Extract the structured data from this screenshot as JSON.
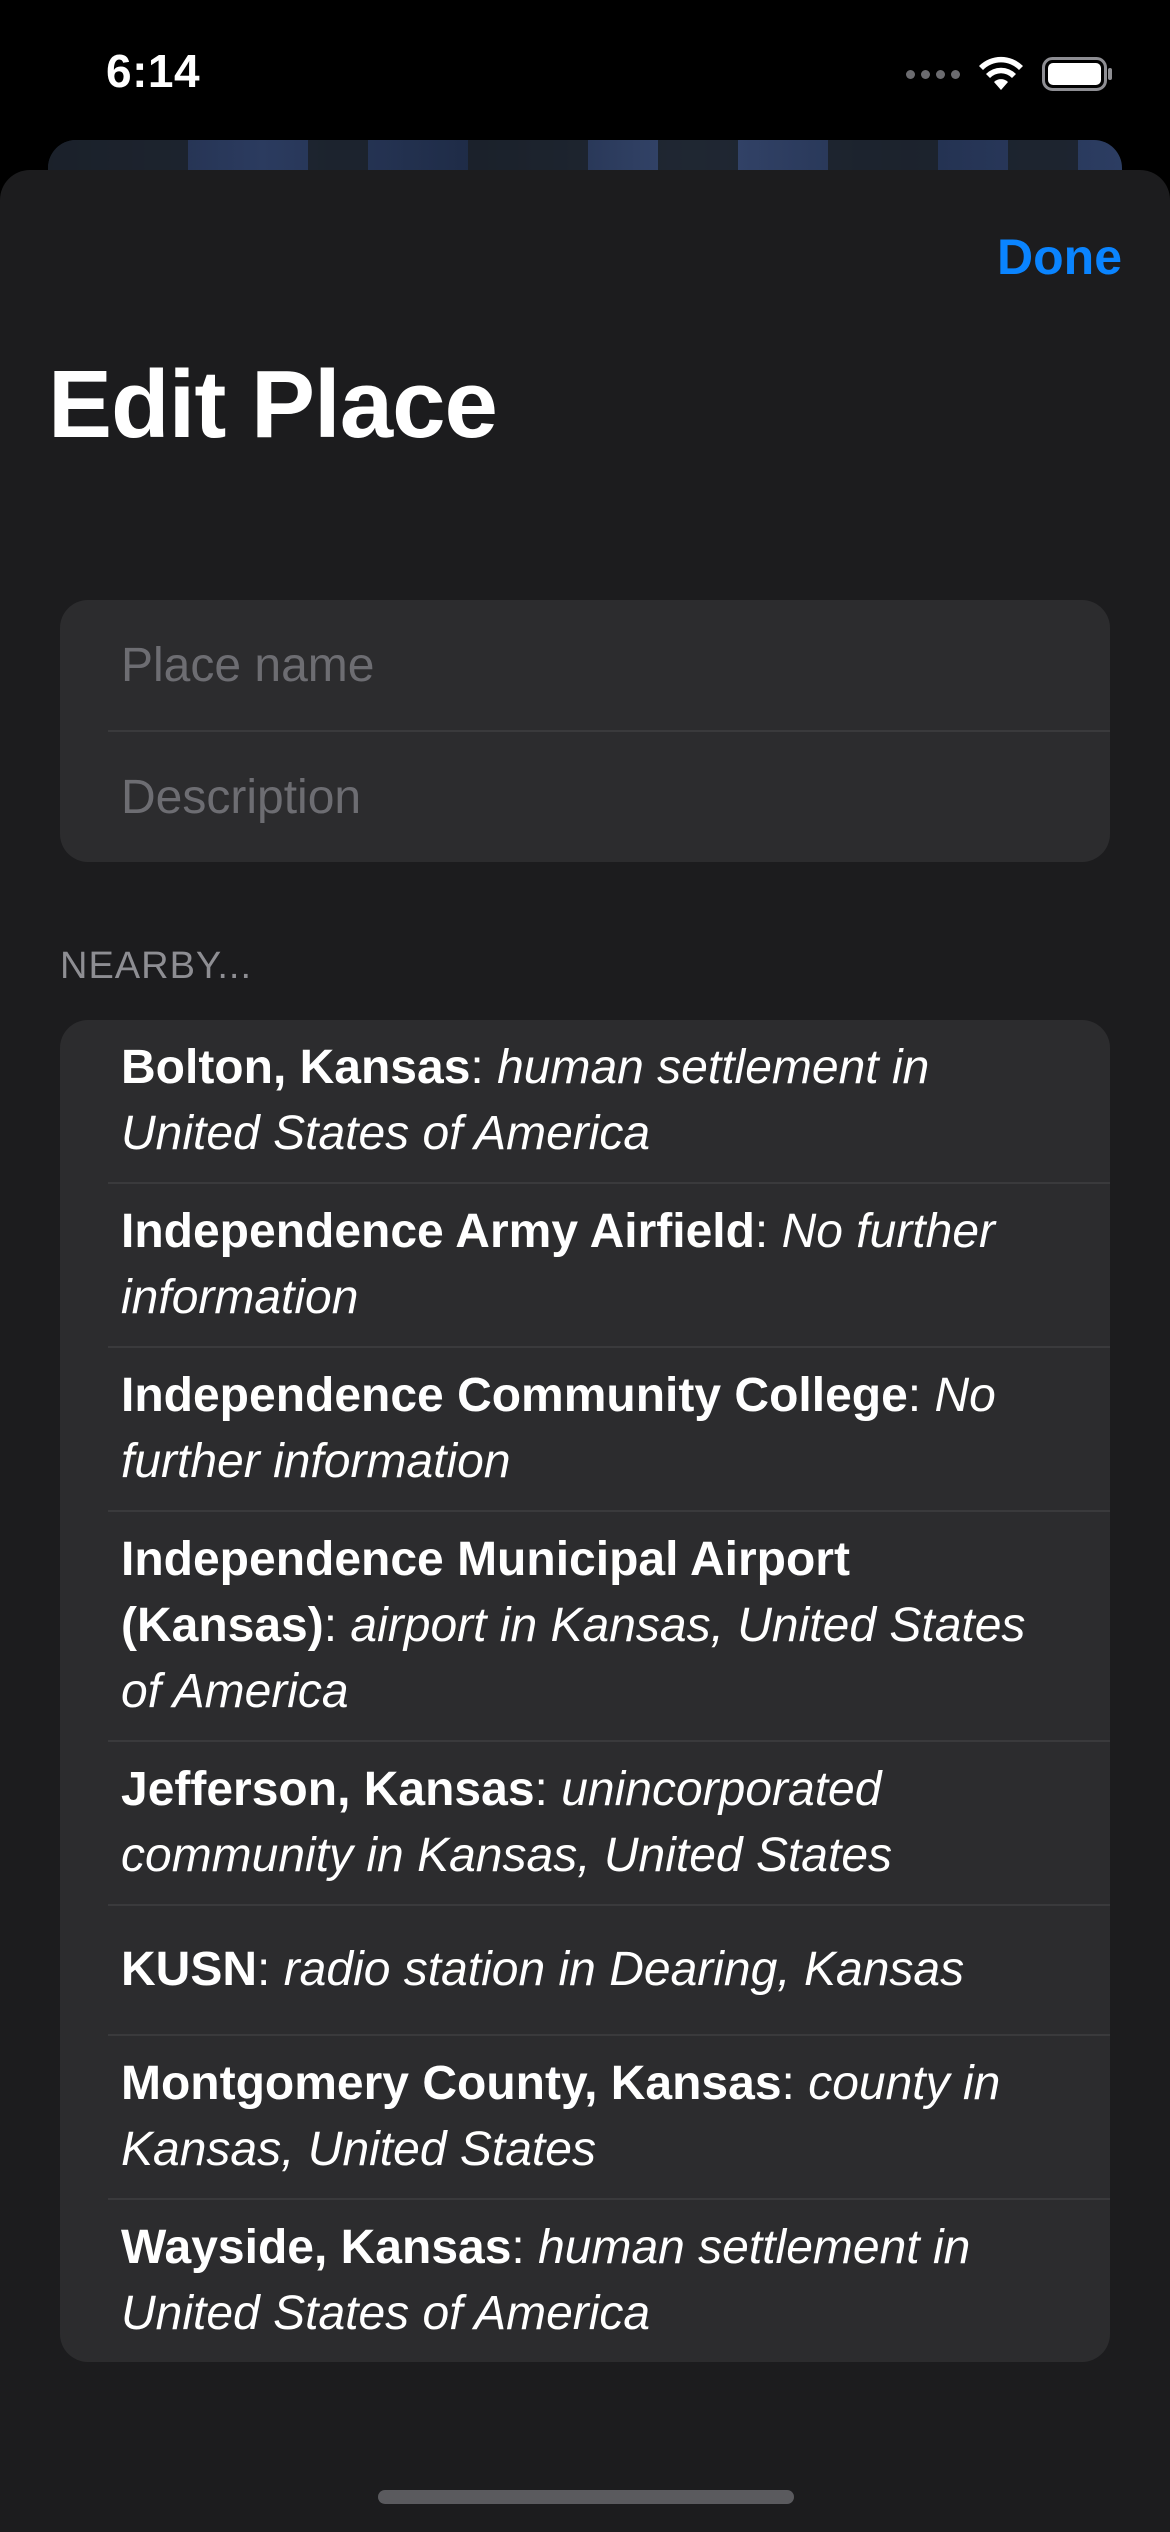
{
  "status_bar": {
    "time": "6:14"
  },
  "header": {
    "done_label": "Done",
    "title": "Edit Place"
  },
  "form": {
    "place_name_placeholder": "Place name",
    "place_name_value": "",
    "description_placeholder": "Description",
    "description_value": ""
  },
  "nearby": {
    "header": "NEARBY...",
    "items": [
      {
        "name": "Bolton, Kansas",
        "separator": ": ",
        "description": "human settlement in United States of America"
      },
      {
        "name": "Independence Army Airfield",
        "separator": ": ",
        "description": "No further information"
      },
      {
        "name": "Independence Community College",
        "separator": ": ",
        "description": "No further information"
      },
      {
        "name": "Independence Municipal Airport (Kansas)",
        "separator": ": ",
        "description": "airport in Kansas, United States of America"
      },
      {
        "name": "Jefferson, Kansas",
        "separator": ": ",
        "description": "unincorporated community in Kansas, United States"
      },
      {
        "name": "KUSN",
        "separator": ": ",
        "description": "radio station in Dearing, Kansas"
      },
      {
        "name": "Montgomery County, Kansas",
        "separator": ": ",
        "description": "county in Kansas, United States"
      },
      {
        "name": "Wayside, Kansas",
        "separator": ": ",
        "description": "human settlement in United States of America"
      }
    ]
  },
  "colors": {
    "accent": "#0a84ff",
    "sheet_background": "#1c1c1e",
    "group_background": "#2c2c2e",
    "secondary_text": "#8e8e93"
  }
}
